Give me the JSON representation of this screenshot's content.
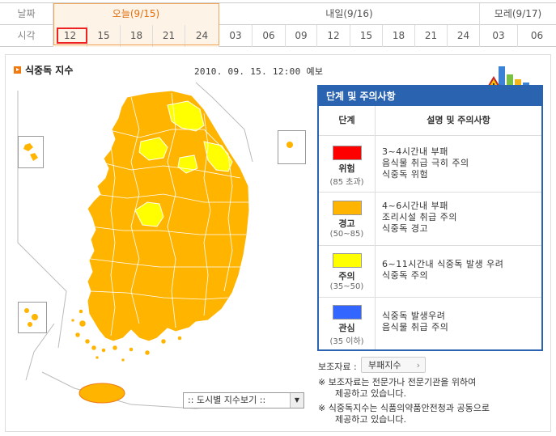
{
  "timebar": {
    "date_label": "날짜",
    "time_label": "시각",
    "days": [
      {
        "label": "오늘(9/15)",
        "hours": [
          "12",
          "15",
          "18",
          "21",
          "24"
        ]
      },
      {
        "label": "내일(9/16)",
        "hours": [
          "03",
          "06",
          "09",
          "12",
          "15",
          "18",
          "21",
          "24"
        ]
      },
      {
        "label": "모레(9/17)",
        "hours": [
          "03",
          "06"
        ]
      }
    ],
    "selected_hour": "12"
  },
  "panel": {
    "title": "식중독 지수",
    "forecast": "2010. 09. 15. 12:00 예보"
  },
  "legend": {
    "header": "단계 및 주의사항",
    "col_level": "단계",
    "col_desc": "설명 및 주의사항",
    "rows": [
      {
        "name": "위험",
        "range": "(85 초과)",
        "color": "#ff0000",
        "lines": [
          "3~4시간내 부패",
          "음식물 취급 극히 주의",
          "식중독 위험"
        ]
      },
      {
        "name": "경고",
        "range": "(50~85)",
        "color": "#ffb400",
        "lines": [
          "4~6시간내 부패",
          "조리시설 취급 주의",
          "식중독 경고"
        ]
      },
      {
        "name": "주의",
        "range": "(35~50)",
        "color": "#ffff00",
        "lines": [
          "6~11시간내 식중독 발생 우려",
          "식중독 주의"
        ]
      },
      {
        "name": "관심",
        "range": "(35 이하)",
        "color": "#3366ff",
        "lines": [
          "식중독 발생우려",
          "음식물 취급 주의"
        ]
      }
    ]
  },
  "source": {
    "label": "보조자료 :",
    "button": "부패지수",
    "notes": [
      "※ 보조자료는 전문가나 전문기관을 위하여",
      "제공하고 있습니다.",
      "※ 식중독지수는 식품의약품안전청과 공동으로",
      "제공하고 있습니다."
    ]
  },
  "city_select": {
    "value": ":: 도시별 지수보기 ::"
  },
  "colors": {
    "orange": "#ffb400",
    "yellow": "#ffff00",
    "accent": "#f07a10",
    "blue": "#2a64b0"
  }
}
